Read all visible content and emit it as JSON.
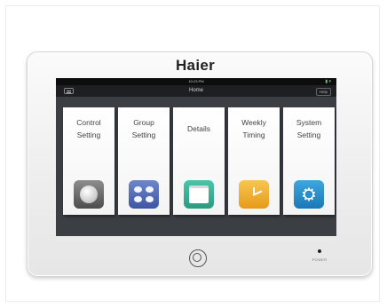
{
  "brand": "Haier",
  "status_bar": {
    "time": "10:23 PM",
    "icons": "▮ ▾"
  },
  "nav": {
    "title": "Home",
    "help": "Help"
  },
  "tiles": [
    {
      "label_line1": "Control",
      "label_line2": "Setting",
      "icon": "knob-icon",
      "color": "#6e6e6e"
    },
    {
      "label_line1": "Group",
      "label_line2": "Setting",
      "icon": "group-icon",
      "color": "#4a62ad"
    },
    {
      "label_line1": "Details",
      "label_line2": "",
      "icon": "details-icon",
      "color": "#36b393"
    },
    {
      "label_line1": "Weekly",
      "label_line2": "Timing",
      "icon": "clock-icon",
      "color": "#f0b13a"
    },
    {
      "label_line1": "System",
      "label_line2": "Setting",
      "icon": "gear-icon",
      "color": "#2a8fd0"
    }
  ],
  "power_label": "POWER"
}
